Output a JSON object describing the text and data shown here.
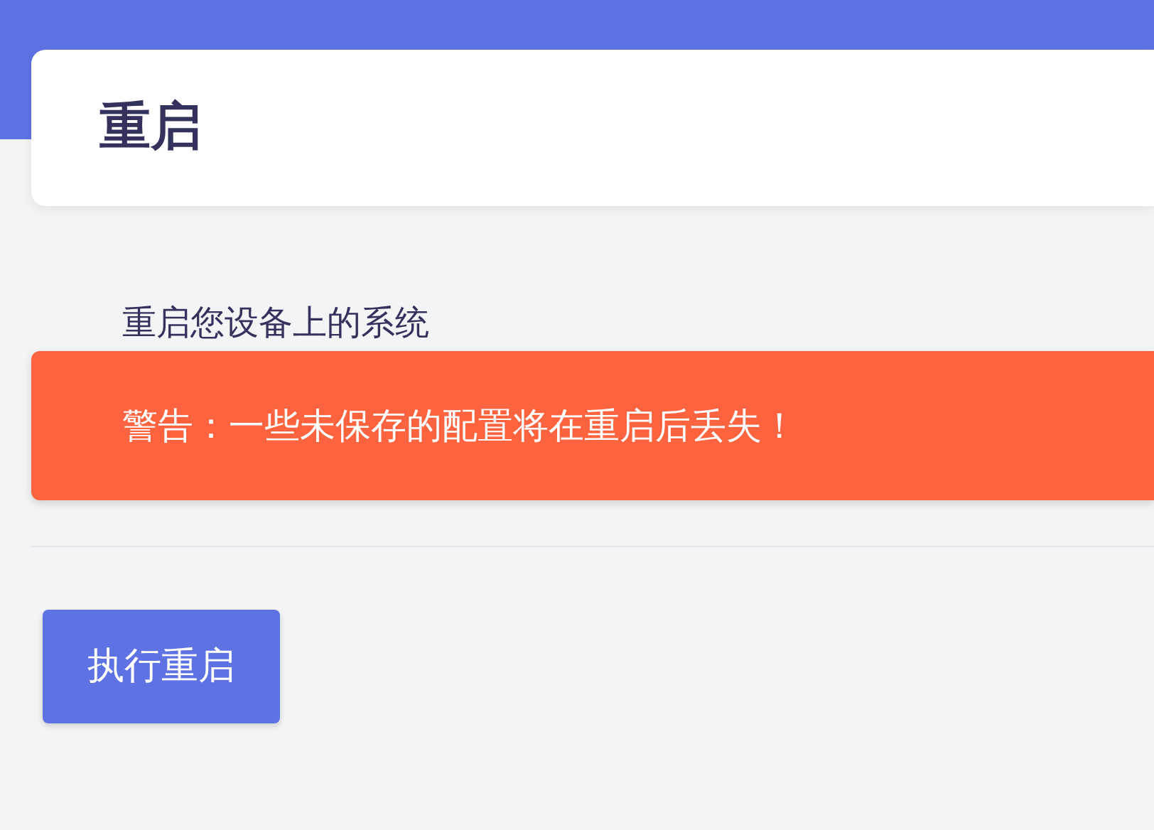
{
  "header": {
    "title": "重启"
  },
  "description": "重启您设备上的系统",
  "alert": {
    "kind": "warning",
    "text": "警告：一些未保存的配置将在重启后丢失！"
  },
  "buttons": [
    {
      "label": "执行重启"
    }
  ]
}
